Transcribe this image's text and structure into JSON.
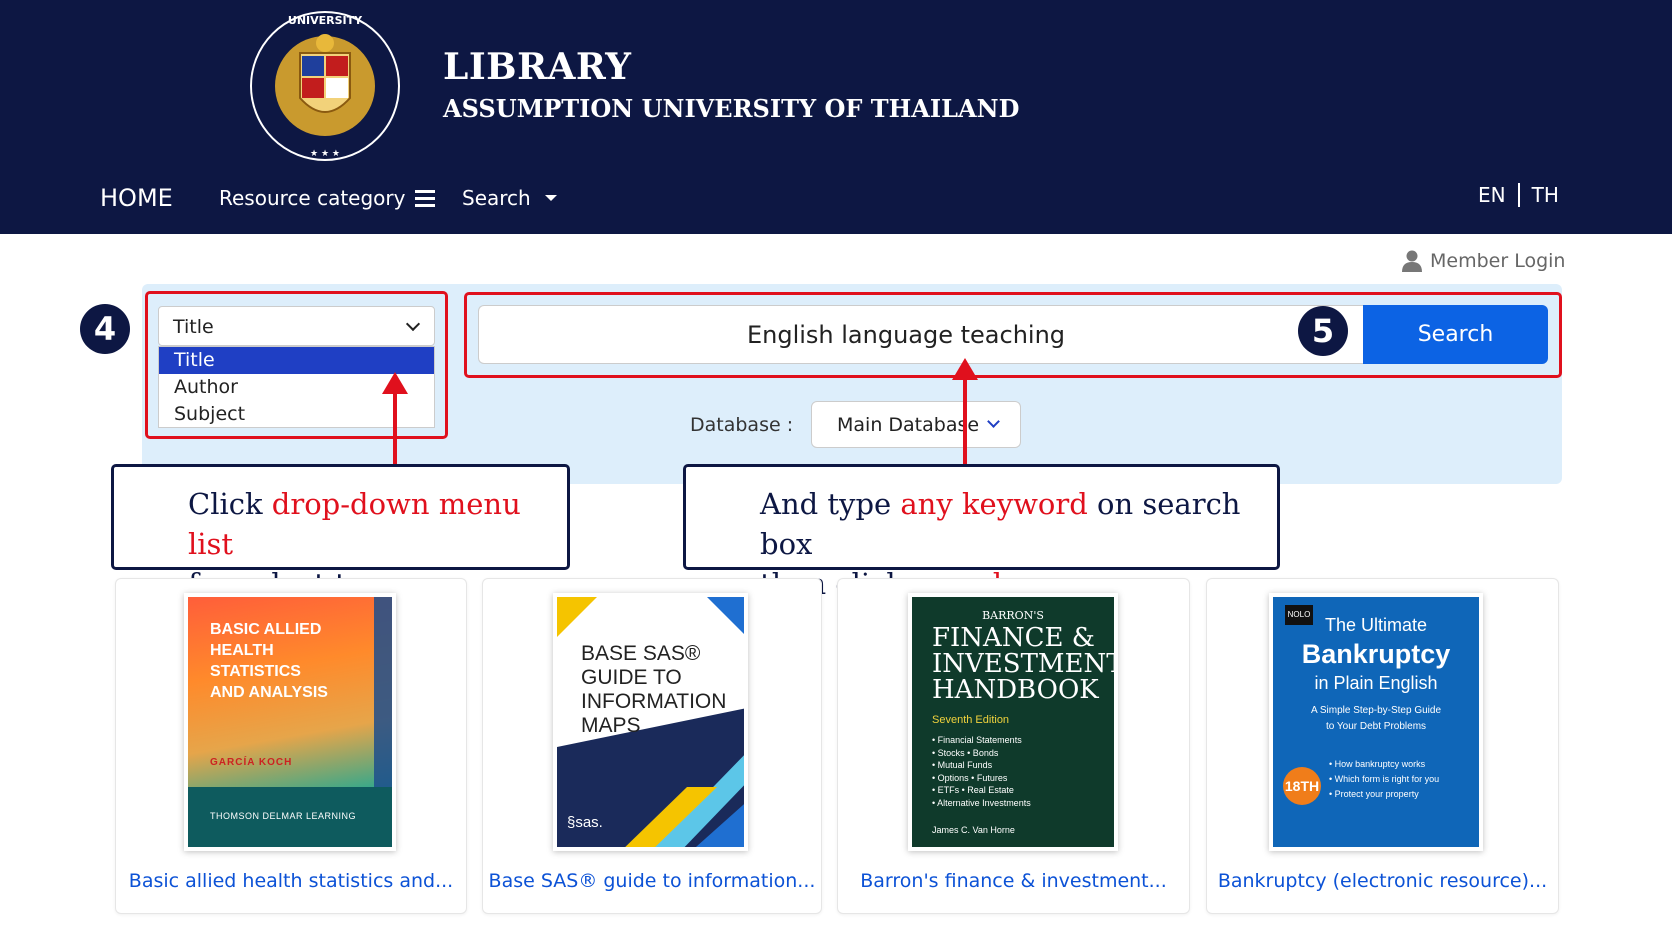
{
  "header": {
    "logo_seal_text": "ASSUMPTION UNIVERSITY OF THAILAND",
    "title": "LIBRARY",
    "subtitle": "ASSUMPTION UNIVERSITY OF THAILAND",
    "nav": {
      "home": "HOME",
      "resource_category": "Resource category",
      "search": "Search"
    },
    "lang": {
      "en": "EN",
      "th": "TH"
    }
  },
  "member_login": "Member Login",
  "search": {
    "type_selected": "Title",
    "type_options": [
      "Title",
      "Author",
      "Subject"
    ],
    "query": "English language teaching",
    "button": "Search",
    "database_label": "Database :",
    "database_selected": "Main Database"
  },
  "annotations": {
    "step4": "4",
    "step5": "5",
    "callout_left": {
      "part1": "Click ",
      "highlight": "drop-down menu list",
      "line2": "for select type"
    },
    "callout_right": {
      "part1": "And type ",
      "highlight1": "any keyword",
      "part2": " on search box",
      "line2_part1": "then click ",
      "highlight2": "search"
    },
    "colors": {
      "highlight": "#e0101d",
      "navy": "#0d1743"
    }
  },
  "books": [
    {
      "caption": "Basic allied health statistics and...",
      "cover_title_lines": [
        "BASIC ALLIED",
        "HEALTH",
        "STATISTICS",
        "AND ANALYSIS"
      ],
      "cover_author": "GARCÍA KOCH",
      "cover_publisher": "THOMSON DELMAR LEARNING"
    },
    {
      "caption": "Base SAS® guide to information...",
      "cover_title_lines": [
        "BASE SAS®",
        "GUIDE TO",
        "INFORMATION",
        "MAPS"
      ],
      "cover_logo": "§sas."
    },
    {
      "caption": "Barron's finance & investment...",
      "cover_publisher": "BARRON'S",
      "cover_title_lines": [
        "FINANCE &",
        "INVESTMENT",
        "HANDBOOK"
      ],
      "cover_edition": "Seventh Edition",
      "cover_list": [
        "• Financial Statements",
        "• Stocks • Bonds",
        "• Mutual Funds",
        "• Options • Futures",
        "• ETFs • Real Estate",
        "• Alternative Investments"
      ],
      "cover_author": "James C. Van Horne"
    },
    {
      "caption": "Bankruptcy (electronic resource)...",
      "cover_logo": "NOLO",
      "cover_title_lines": [
        "The Ultimate",
        "Bankruptcy",
        "in Plain English"
      ],
      "cover_subtitle_lines": [
        "A Simple Step-by-Step Guide",
        "to Your Debt Problems"
      ],
      "cover_badge": "18TH",
      "cover_list": [
        "• How bankruptcy works",
        "• Which form is right for you",
        "• Protect your property"
      ]
    }
  ]
}
